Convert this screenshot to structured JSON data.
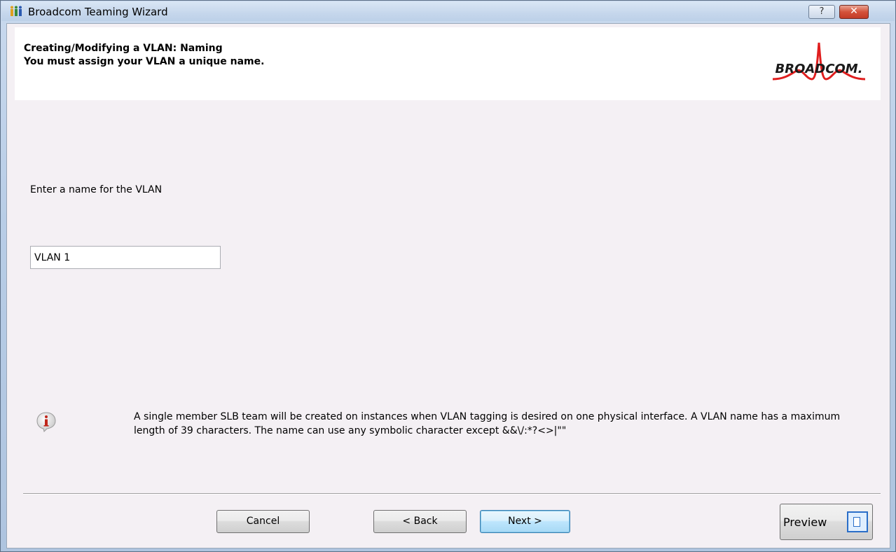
{
  "window": {
    "title": "Broadcom Teaming Wizard",
    "help_label": "?",
    "close_label": "✕"
  },
  "header": {
    "line1": "Creating/Modifying a VLAN:  Naming",
    "line2": "You must assign your VLAN a unique name.",
    "logo_text": "BROADCOM."
  },
  "form": {
    "prompt": "Enter a name for the VLAN",
    "name_value": "VLAN 1"
  },
  "info": {
    "icon": "info-icon",
    "text": "A single member SLB team will be created on instances when VLAN tagging is desired on one physical interface. A VLAN name has a maximum length of 39 characters. The name can use any symbolic character except &&\\/:*?<>|\"\""
  },
  "buttons": {
    "cancel": "Cancel",
    "back": "< Back",
    "next": "Next >",
    "preview": "Preview"
  },
  "colors": {
    "logo_red": "#e01e1e",
    "logo_text": "#1a1a1a",
    "default_button_border": "#3c7fb1"
  }
}
